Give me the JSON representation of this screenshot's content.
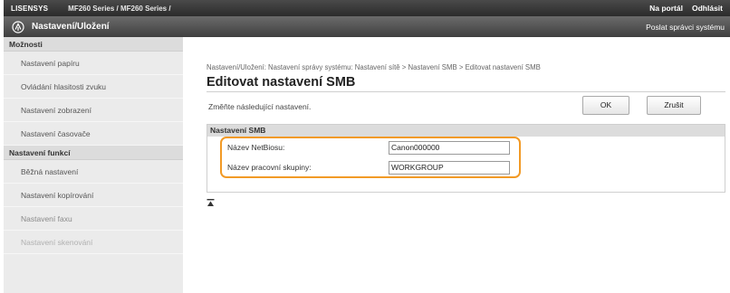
{
  "topbar": {
    "user": "LISENSYS",
    "model": "MF260 Series / MF260 Series /",
    "portal": "Na portál",
    "logout": "Odhlásit"
  },
  "titlebar": {
    "title": "Nastavení/Uložení",
    "admin_mail": "Poslat správci systému"
  },
  "sidebar": {
    "sections": [
      {
        "header": "Možnosti",
        "items": [
          {
            "label": "Nastavení papíru"
          },
          {
            "label": "Ovládání hlasitosti zvuku"
          },
          {
            "label": "Nastavení zobrazení"
          },
          {
            "label": "Nastavení časovače"
          }
        ]
      },
      {
        "header": "Nastavení funkcí",
        "items": [
          {
            "label": "Běžná nastavení"
          },
          {
            "label": "Nastavení kopírování"
          },
          {
            "label": "Nastavení faxu"
          },
          {
            "label": "Nastavení skenování"
          }
        ]
      }
    ]
  },
  "main": {
    "breadcrumb": "Nastavení/Uložení: Nastavení správy systému: Nastavení sítě > Nastavení SMB > Editovat nastavení SMB",
    "title": "Editovat nastavení SMB",
    "instruction": "Změňte následující nastavení.",
    "ok_label": "OK",
    "cancel_label": "Zrušit",
    "section": {
      "header": "Nastavení SMB",
      "netbios_label": "Název NetBiosu:",
      "netbios_value": "Canon000000",
      "workgroup_label": "Název pracovní skupiny:",
      "workgroup_value": "WORKGROUP"
    }
  },
  "colors": {
    "highlight": "#f29a26",
    "topbar": "#2b2b2b",
    "titlebar": "#4a4a4a"
  },
  "icons": {
    "logo": "settings-register-icon",
    "top_anchor": "go-to-top-icon"
  }
}
